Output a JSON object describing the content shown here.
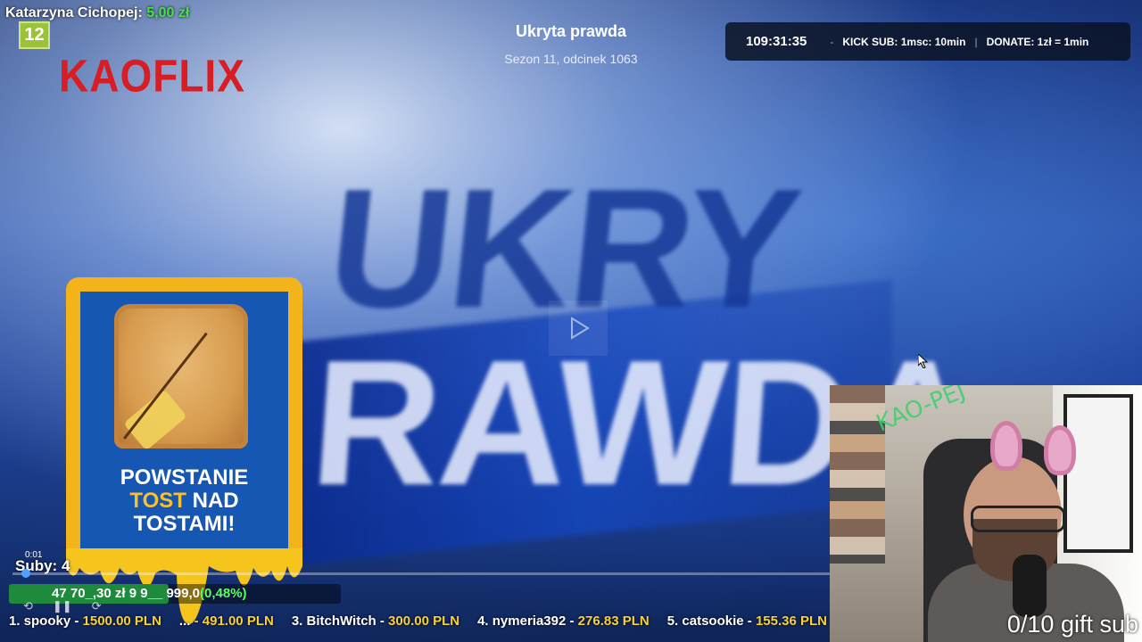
{
  "donor": {
    "name": "Katarzyna Cichopej:",
    "amount": "5,00 zł"
  },
  "age_badge": "12",
  "brand": "KAOFLIX",
  "show": {
    "title": "Ukryta prawda",
    "episode": "Sezon 11, odcinek 1063"
  },
  "timer": {
    "time": "109:31:35",
    "sep1": "-",
    "kick_sub": "KICK SUB: 1msc: 10min",
    "sep2": "|",
    "donate": "DONATE: 1zł = 1min"
  },
  "promo": {
    "line1": "POWSTANIE",
    "line2a": "TOST",
    "line2b": "NAD",
    "line3": "TOSTAMI!"
  },
  "video_text": {
    "top": "UKRY",
    "bottom": "RAWDA"
  },
  "player": {
    "elapsed": "0:01",
    "progress_fraction": 0.01
  },
  "subs": {
    "label": "Suby: 4"
  },
  "goal": {
    "current": "47 70_,30 zł",
    "target": "9 9__ 999,0",
    "percent": "0,48%",
    "fill_fraction": 0.48
  },
  "controls": [
    "rewind-10-icon",
    "pause-icon",
    "forward-10-icon"
  ],
  "ticker": [
    {
      "name": "1. spooky -",
      "amount": "1500.00 PLN"
    },
    {
      "name": "...",
      "amount": "- 491.00 PLN"
    },
    {
      "name": "3. BitchWitch -",
      "amount": "300.00 PLN"
    },
    {
      "name": "4. nymeria392 -",
      "amount": "276.83 PLN"
    },
    {
      "name": "5. catsookie -",
      "amount": "155.36 PLN"
    }
  ],
  "webcam": {
    "gift_sub": "0/10 gift sub",
    "wall_scrawl": "KAO-PEJ"
  },
  "colors": {
    "brand_red": "#d81e25",
    "donor_green": "#48e04a",
    "promo_yellow": "#f3b41b",
    "promo_blue": "#1657b3",
    "ticker_amount": "#f5d13a"
  }
}
